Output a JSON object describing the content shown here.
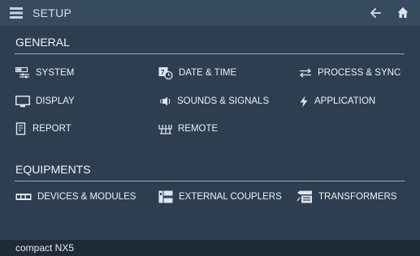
{
  "header": {
    "title": "SETUP"
  },
  "general": {
    "title": "GENERAL",
    "items": [
      {
        "label": "SYSTEM"
      },
      {
        "label": "DATE & TIME"
      },
      {
        "label": "PROCESS & SYNC"
      },
      {
        "label": "DISPLAY"
      },
      {
        "label": "SOUNDS & SIGNALS"
      },
      {
        "label": "APPLICATION"
      },
      {
        "label": "REPORT"
      },
      {
        "label": "REMOTE"
      }
    ]
  },
  "equipments": {
    "title": "EQUIPMENTS",
    "items": [
      {
        "label": "DEVICES & MODULES"
      },
      {
        "label": "EXTERNAL COUPLERS"
      },
      {
        "label": "TRANSFORMERS"
      }
    ]
  },
  "footer": {
    "device_name": "compact NX5"
  },
  "colors": {
    "background": "#2d3e50",
    "topbar": "#364b60",
    "footer": "#1f2b38",
    "text": "#ffffff"
  }
}
